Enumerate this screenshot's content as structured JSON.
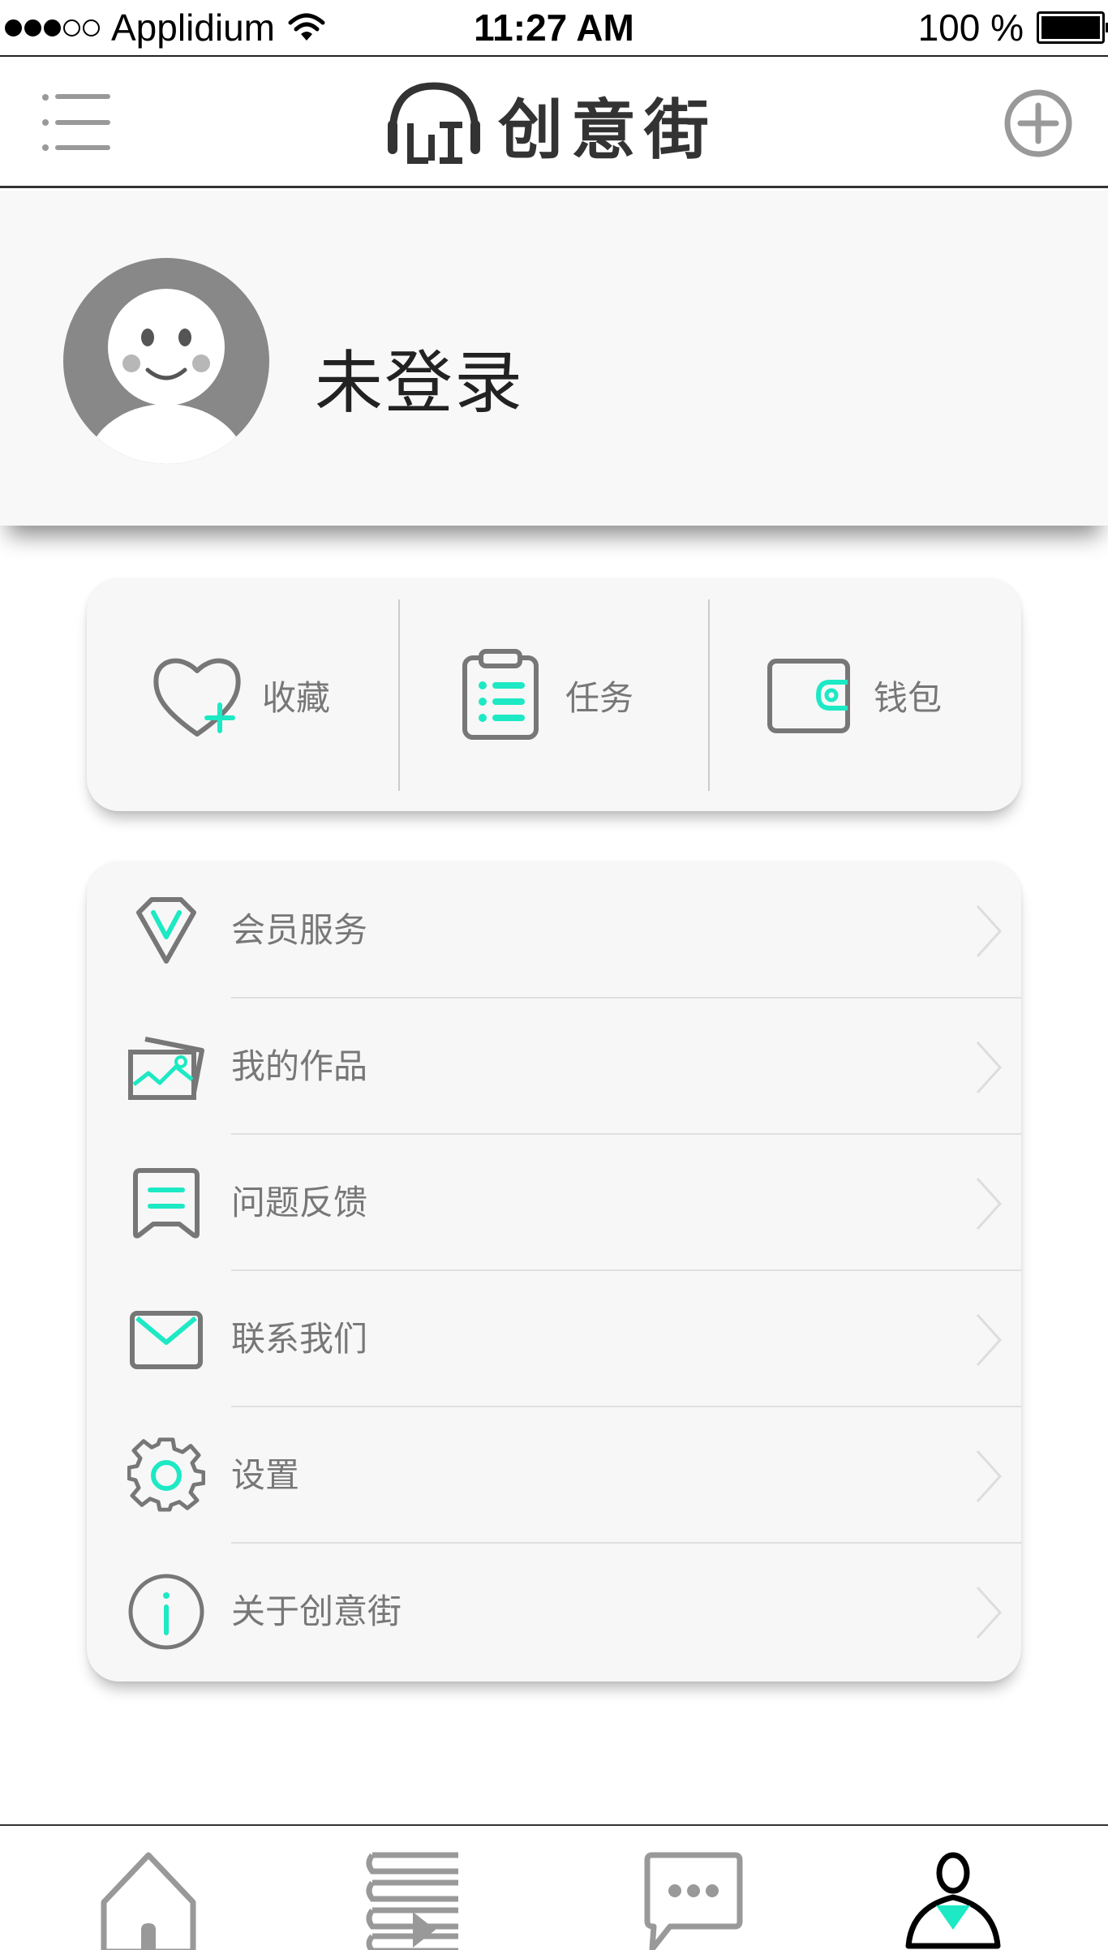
{
  "status_bar": {
    "carrier": "Applidium",
    "time": "11:27 AM",
    "battery": "100 %",
    "signal_dots": [
      true,
      true,
      true,
      false,
      false
    ]
  },
  "nav": {
    "logo_text": "创意街",
    "menu_icon": "hamburger-icon",
    "add_icon": "plus-circle-icon"
  },
  "profile": {
    "name": "未登录"
  },
  "quick_actions": [
    {
      "label": "收藏",
      "icon": "heart-plus-icon"
    },
    {
      "label": "任务",
      "icon": "clipboard-list-icon"
    },
    {
      "label": "钱包",
      "icon": "wallet-icon"
    }
  ],
  "menu": [
    {
      "label": "会员服务",
      "icon": "diamond-v-icon"
    },
    {
      "label": "我的作品",
      "icon": "photos-icon"
    },
    {
      "label": "问题反馈",
      "icon": "feedback-icon"
    },
    {
      "label": "联系我们",
      "icon": "mail-icon"
    },
    {
      "label": "设置",
      "icon": "gear-icon"
    },
    {
      "label": "关于创意街",
      "icon": "info-icon"
    }
  ],
  "tabs": [
    {
      "icon": "home-icon",
      "active": false
    },
    {
      "icon": "books-icon",
      "active": false
    },
    {
      "icon": "chat-icon",
      "active": false
    },
    {
      "icon": "profile-icon",
      "active": true
    }
  ],
  "colors": {
    "accent": "#1de9c4",
    "icon_gray": "#777777",
    "text_gray": "#777777",
    "card_bg": "#f7f7f7"
  }
}
